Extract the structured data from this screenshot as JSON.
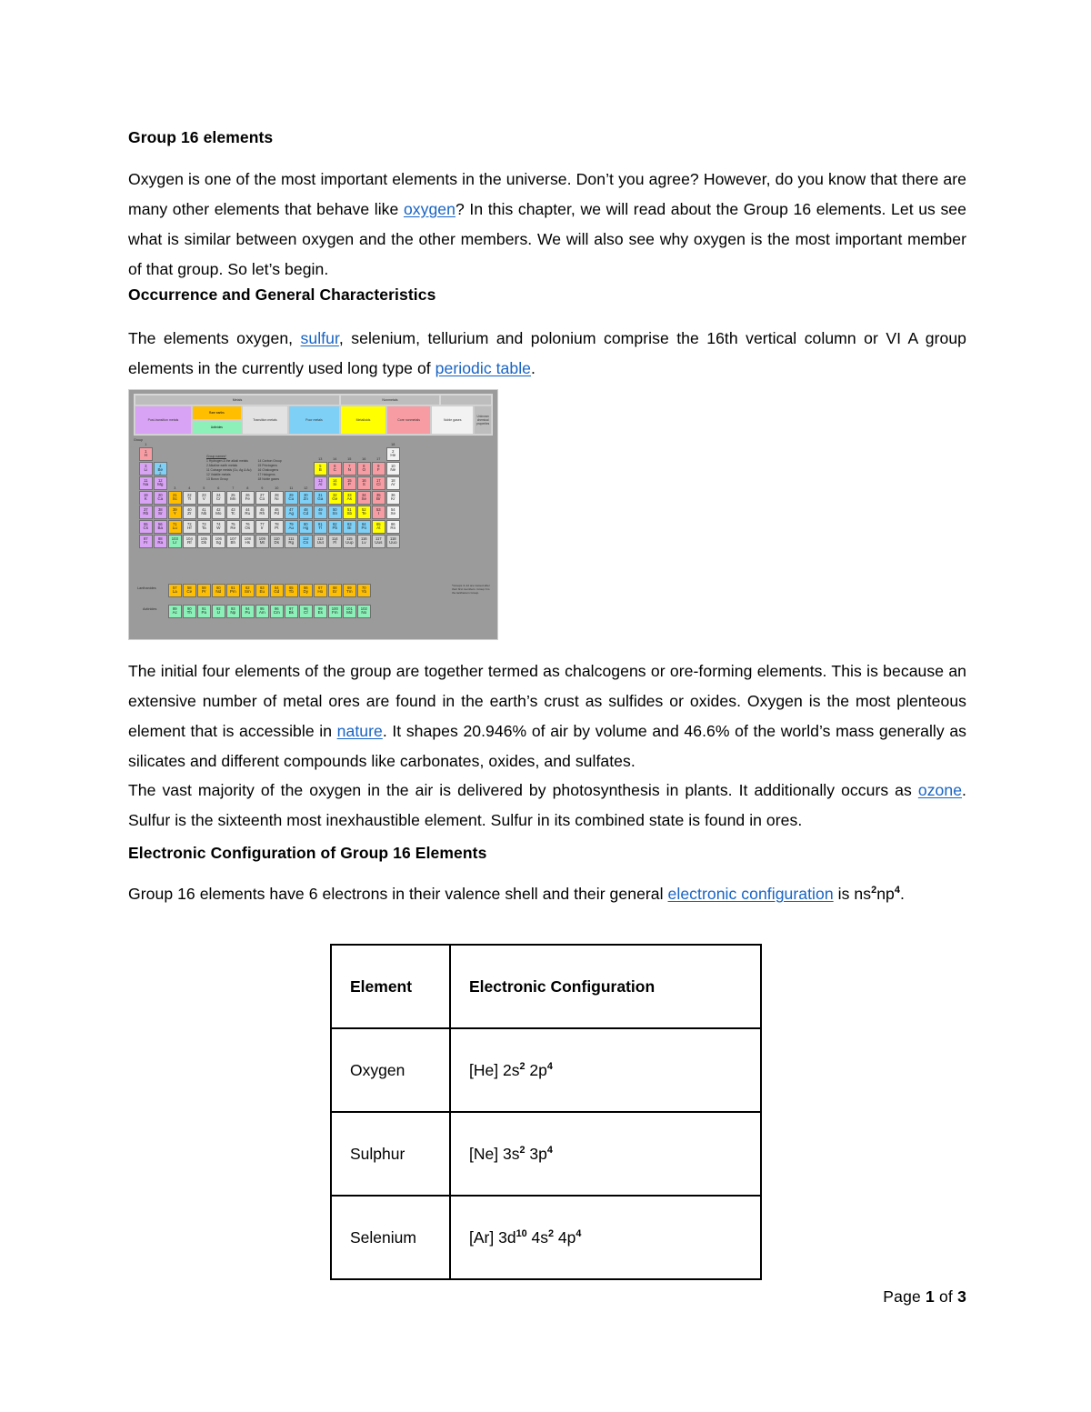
{
  "document": {
    "title": "Group 16 elements",
    "sections": [
      {
        "heading": "Group 16 elements",
        "paragraph_pre": "Oxygen is one of the most important elements in the universe. Don’t you agree? However, do you know that there are many other elements that behave like ",
        "link": "oxygen",
        "paragraph_post": "? In this chapter, we will read about the Group 16 elements. Let us see what is similar between oxygen and the other members. We will also see why oxygen is the most important member of that group. So let’s begin."
      },
      {
        "heading": "Occurrence and General Characteristics",
        "p2_a": "The elements oxygen, ",
        "p2_link1": "sulfur",
        "p2_b": ", selenium, tellurium and polonium comprise the 16th vertical column or VI A group elements in the currently used long type of ",
        "p2_link2": "periodic table",
        "p2_c": ".",
        "p3_a": "The initial four elements of the group are together termed as chalcogens or ore-forming elements. This is because an extensive number of metal ores are found in the earth’s crust as sulfides or oxides. Oxygen is the most plenteous element that is accessible in ",
        "p3_link": "nature",
        "p3_b": ". It shapes 20.946% of air by volume and 46.6% of the world’s mass generally as silicates and different compounds like carbonates, oxides, and sulfates.",
        "p4_a": "The vast majority of the oxygen in the air is delivered by photosynthesis in plants. It additionally occurs as ",
        "p4_link": "ozone",
        "p4_b": ". Sulfur is the sixteenth most inexhaustible element. Sulfur in its combined state is found in ores."
      },
      {
        "heading": "Electronic Configuration of Group 16 Elements",
        "p5_a": "Group 16 elements have 6 electrons in their valence shell and their general ",
        "p5_link": "electronic configuration",
        "p5_b": " is ns",
        "p5_sup1": "2",
        "p5_c": "np",
        "p5_sup2": "4",
        "p5_d": "."
      }
    ]
  },
  "config_table": {
    "headers": [
      "Element",
      "Electronic Configuration"
    ],
    "rows": [
      {
        "element": "Oxygen",
        "config_pre": "[He] 2s",
        "sup1": "2",
        "config_mid": " 2p",
        "sup2": "4",
        "config_post": ""
      },
      {
        "element": "Sulphur",
        "config_pre": "[Ne] 3s",
        "sup1": "2",
        "config_mid": " 3p",
        "sup2": "4",
        "config_post": ""
      },
      {
        "element": "Selenium",
        "config_pre": "[Ar] 3d",
        "sup1": "10",
        "config_mid": " 4s",
        "sup2": "2",
        "config_post": " 4p",
        "sup3": "4"
      }
    ]
  },
  "periodic_table_image": {
    "alt": "periodic-table-of-the-elements",
    "legend": {
      "metals_header": "Metals",
      "nonmetals_header": "Nonmetals",
      "unknown_header": "Unknown chemical properties",
      "categories": [
        "Post-transition metals",
        "Rare earths",
        "Actinides",
        "Transition metals",
        "Poor metals",
        "Metalloids",
        "Core nonmetals",
        "Noble gases",
        "Unknown chemical properties"
      ]
    },
    "group_label": "Group",
    "group_names_title": "Group names*",
    "group_names": [
      "1  Hydrogen & the alkali metals",
      "2  Alkaline earth metals",
      "11  Coinage metals (Cu, Ag & Au)",
      "12  Volatile metals",
      "13  Boron Group",
      "14  Carbon Group",
      "15  Pnictogens",
      "16  Chalcogens",
      "17  Halogens",
      "18  Noble gases"
    ],
    "series_labels": [
      "Lanthanides",
      "Actinides"
    ],
    "footnote": "*Groups 3–12 are named after their first members. Group 3 is the lanthanum Group.",
    "colors": {
      "background": "#9b9b9b",
      "alkali": "#f79ca3",
      "alkaline_earth": "#d9a3f5",
      "transition": "#e2e2e2",
      "poor_metals": "#7fd0f7",
      "metalloids": "#ffff00",
      "nonmetals": "#f79ca3",
      "noble_gases": "#f2f2f2",
      "lanthanides": "#ffbf00",
      "actinides": "#8cf0b8"
    },
    "elements": [
      {
        "z": "1",
        "sym": "H",
        "col": 1,
        "row": 1,
        "cat": "alkali"
      },
      {
        "z": "2",
        "sym": "He",
        "col": 18,
        "row": 1,
        "cat": "noble"
      },
      {
        "z": "3",
        "sym": "Li",
        "col": 1,
        "row": 2,
        "cat": "alkaline"
      },
      {
        "z": "4",
        "sym": "Be",
        "col": 2,
        "row": 2,
        "cat": "ptm"
      },
      {
        "z": "5",
        "sym": "B",
        "col": 13,
        "row": 2,
        "cat": "metalloid"
      },
      {
        "z": "6",
        "sym": "C",
        "col": 14,
        "row": 2,
        "cat": "nonmetal"
      },
      {
        "z": "7",
        "sym": "N",
        "col": 15,
        "row": 2,
        "cat": "nonmetal"
      },
      {
        "z": "8",
        "sym": "O",
        "col": 16,
        "row": 2,
        "cat": "nonmetal"
      },
      {
        "z": "9",
        "sym": "F",
        "col": 17,
        "row": 2,
        "cat": "nonmetal"
      },
      {
        "z": "10",
        "sym": "Ne",
        "col": 18,
        "row": 2,
        "cat": "noble"
      },
      {
        "z": "11",
        "sym": "Na",
        "col": 1,
        "row": 3,
        "cat": "alkaline"
      },
      {
        "z": "12",
        "sym": "Mg",
        "col": 2,
        "row": 3,
        "cat": "alkaline"
      },
      {
        "z": "13",
        "sym": "Al",
        "col": 13,
        "row": 3,
        "cat": "alkaline"
      },
      {
        "z": "14",
        "sym": "Si",
        "col": 14,
        "row": 3,
        "cat": "metalloid"
      },
      {
        "z": "15",
        "sym": "P",
        "col": 15,
        "row": 3,
        "cat": "nonmetal"
      },
      {
        "z": "16",
        "sym": "S",
        "col": 16,
        "row": 3,
        "cat": "nonmetal"
      },
      {
        "z": "17",
        "sym": "Cl",
        "col": 17,
        "row": 3,
        "cat": "nonmetal"
      },
      {
        "z": "18",
        "sym": "Ar",
        "col": 18,
        "row": 3,
        "cat": "noble"
      },
      {
        "z": "19",
        "sym": "K",
        "col": 1,
        "row": 4,
        "cat": "alkaline"
      },
      {
        "z": "20",
        "sym": "Ca",
        "col": 2,
        "row": 4,
        "cat": "alkaline"
      },
      {
        "z": "21",
        "sym": "Sc",
        "col": 3,
        "row": 4,
        "cat": "lanth"
      },
      {
        "z": "22",
        "sym": "Ti",
        "col": 4,
        "row": 4,
        "cat": "trans"
      },
      {
        "z": "23",
        "sym": "V",
        "col": 5,
        "row": 4,
        "cat": "trans"
      },
      {
        "z": "24",
        "sym": "Cr",
        "col": 6,
        "row": 4,
        "cat": "trans"
      },
      {
        "z": "25",
        "sym": "Mn",
        "col": 7,
        "row": 4,
        "cat": "trans"
      },
      {
        "z": "26",
        "sym": "Fe",
        "col": 8,
        "row": 4,
        "cat": "trans"
      },
      {
        "z": "27",
        "sym": "Co",
        "col": 9,
        "row": 4,
        "cat": "trans"
      },
      {
        "z": "28",
        "sym": "Ni",
        "col": 10,
        "row": 4,
        "cat": "trans"
      },
      {
        "z": "29",
        "sym": "Cu",
        "col": 11,
        "row": 4,
        "cat": "ptm"
      },
      {
        "z": "30",
        "sym": "Zn",
        "col": 12,
        "row": 4,
        "cat": "ptm"
      },
      {
        "z": "31",
        "sym": "Ga",
        "col": 13,
        "row": 4,
        "cat": "ptm"
      },
      {
        "z": "32",
        "sym": "Ge",
        "col": 14,
        "row": 4,
        "cat": "metalloid"
      },
      {
        "z": "33",
        "sym": "As",
        "col": 15,
        "row": 4,
        "cat": "metalloid"
      },
      {
        "z": "34",
        "sym": "Se",
        "col": 16,
        "row": 4,
        "cat": "nonmetal"
      },
      {
        "z": "35",
        "sym": "Br",
        "col": 17,
        "row": 4,
        "cat": "nonmetal"
      },
      {
        "z": "36",
        "sym": "Kr",
        "col": 18,
        "row": 4,
        "cat": "noble"
      },
      {
        "z": "37",
        "sym": "Rb",
        "col": 1,
        "row": 5,
        "cat": "alkaline"
      },
      {
        "z": "38",
        "sym": "Sr",
        "col": 2,
        "row": 5,
        "cat": "alkaline"
      },
      {
        "z": "39",
        "sym": "Y",
        "col": 3,
        "row": 5,
        "cat": "lanth"
      },
      {
        "z": "40",
        "sym": "Zr",
        "col": 4,
        "row": 5,
        "cat": "trans"
      },
      {
        "z": "41",
        "sym": "Nb",
        "col": 5,
        "row": 5,
        "cat": "trans"
      },
      {
        "z": "42",
        "sym": "Mo",
        "col": 6,
        "row": 5,
        "cat": "trans"
      },
      {
        "z": "43",
        "sym": "Tc",
        "col": 7,
        "row": 5,
        "cat": "trans"
      },
      {
        "z": "44",
        "sym": "Ru",
        "col": 8,
        "row": 5,
        "cat": "trans"
      },
      {
        "z": "45",
        "sym": "Rh",
        "col": 9,
        "row": 5,
        "cat": "trans"
      },
      {
        "z": "46",
        "sym": "Pd",
        "col": 10,
        "row": 5,
        "cat": "trans"
      },
      {
        "z": "47",
        "sym": "Ag",
        "col": 11,
        "row": 5,
        "cat": "ptm"
      },
      {
        "z": "48",
        "sym": "Cd",
        "col": 12,
        "row": 5,
        "cat": "ptm"
      },
      {
        "z": "49",
        "sym": "In",
        "col": 13,
        "row": 5,
        "cat": "ptm"
      },
      {
        "z": "50",
        "sym": "Sn",
        "col": 14,
        "row": 5,
        "cat": "ptm"
      },
      {
        "z": "51",
        "sym": "Sb",
        "col": 15,
        "row": 5,
        "cat": "metalloid"
      },
      {
        "z": "52",
        "sym": "Te",
        "col": 16,
        "row": 5,
        "cat": "metalloid"
      },
      {
        "z": "53",
        "sym": "I",
        "col": 17,
        "row": 5,
        "cat": "nonmetal"
      },
      {
        "z": "54",
        "sym": "Xe",
        "col": 18,
        "row": 5,
        "cat": "noble"
      },
      {
        "z": "55",
        "sym": "Cs",
        "col": 1,
        "row": 6,
        "cat": "alkaline"
      },
      {
        "z": "56",
        "sym": "Ba",
        "col": 2,
        "row": 6,
        "cat": "alkaline"
      },
      {
        "z": "71",
        "sym": "Lu",
        "col": 3,
        "row": 6,
        "cat": "lanth"
      },
      {
        "z": "72",
        "sym": "Hf",
        "col": 4,
        "row": 6,
        "cat": "trans"
      },
      {
        "z": "73",
        "sym": "Ta",
        "col": 5,
        "row": 6,
        "cat": "trans"
      },
      {
        "z": "74",
        "sym": "W",
        "col": 6,
        "row": 6,
        "cat": "trans"
      },
      {
        "z": "75",
        "sym": "Re",
        "col": 7,
        "row": 6,
        "cat": "trans"
      },
      {
        "z": "76",
        "sym": "Os",
        "col": 8,
        "row": 6,
        "cat": "trans"
      },
      {
        "z": "77",
        "sym": "Ir",
        "col": 9,
        "row": 6,
        "cat": "trans"
      },
      {
        "z": "78",
        "sym": "Pt",
        "col": 10,
        "row": 6,
        "cat": "trans"
      },
      {
        "z": "79",
        "sym": "Au",
        "col": 11,
        "row": 6,
        "cat": "ptm"
      },
      {
        "z": "80",
        "sym": "Hg",
        "col": 12,
        "row": 6,
        "cat": "ptm"
      },
      {
        "z": "81",
        "sym": "Tl",
        "col": 13,
        "row": 6,
        "cat": "ptm"
      },
      {
        "z": "82",
        "sym": "Pb",
        "col": 14,
        "row": 6,
        "cat": "ptm"
      },
      {
        "z": "83",
        "sym": "Bi",
        "col": 15,
        "row": 6,
        "cat": "ptm"
      },
      {
        "z": "84",
        "sym": "Po",
        "col": 16,
        "row": 6,
        "cat": "ptm"
      },
      {
        "z": "85",
        "sym": "At",
        "col": 17,
        "row": 6,
        "cat": "metalloid"
      },
      {
        "z": "86",
        "sym": "Rn",
        "col": 18,
        "row": 6,
        "cat": "noble"
      },
      {
        "z": "87",
        "sym": "Fr",
        "col": 1,
        "row": 7,
        "cat": "alkaline"
      },
      {
        "z": "88",
        "sym": "Ra",
        "col": 2,
        "row": 7,
        "cat": "alkaline"
      },
      {
        "z": "103",
        "sym": "Lr",
        "col": 3,
        "row": 7,
        "cat": "actin"
      },
      {
        "z": "104",
        "sym": "Rf",
        "col": 4,
        "row": 7,
        "cat": "trans"
      },
      {
        "z": "105",
        "sym": "Db",
        "col": 5,
        "row": 7,
        "cat": "trans"
      },
      {
        "z": "106",
        "sym": "Sg",
        "col": 6,
        "row": 7,
        "cat": "trans"
      },
      {
        "z": "107",
        "sym": "Bh",
        "col": 7,
        "row": 7,
        "cat": "trans"
      },
      {
        "z": "108",
        "sym": "Hs",
        "col": 8,
        "row": 7,
        "cat": "trans"
      },
      {
        "z": "109",
        "sym": "Mt",
        "col": 9,
        "row": 7,
        "cat": "unknown"
      },
      {
        "z": "110",
        "sym": "Ds",
        "col": 10,
        "row": 7,
        "cat": "unknown"
      },
      {
        "z": "111",
        "sym": "Rg",
        "col": 11,
        "row": 7,
        "cat": "unknown"
      },
      {
        "z": "112",
        "sym": "Cn",
        "col": 12,
        "row": 7,
        "cat": "ptm"
      },
      {
        "z": "113",
        "sym": "Uut",
        "col": 13,
        "row": 7,
        "cat": "unknown"
      },
      {
        "z": "114",
        "sym": "Fl",
        "col": 14,
        "row": 7,
        "cat": "unknown"
      },
      {
        "z": "115",
        "sym": "Uup",
        "col": 15,
        "row": 7,
        "cat": "unknown"
      },
      {
        "z": "116",
        "sym": "Lv",
        "col": 16,
        "row": 7,
        "cat": "unknown"
      },
      {
        "z": "117",
        "sym": "Uus",
        "col": 17,
        "row": 7,
        "cat": "unknown"
      },
      {
        "z": "118",
        "sym": "Uuo",
        "col": 18,
        "row": 7,
        "cat": "unknown"
      }
    ],
    "lanthanides": [
      {
        "z": "57",
        "sym": "La"
      },
      {
        "z": "58",
        "sym": "Ce"
      },
      {
        "z": "59",
        "sym": "Pr"
      },
      {
        "z": "60",
        "sym": "Nd"
      },
      {
        "z": "61",
        "sym": "Pm"
      },
      {
        "z": "62",
        "sym": "Sm"
      },
      {
        "z": "63",
        "sym": "Eu"
      },
      {
        "z": "64",
        "sym": "Gd"
      },
      {
        "z": "65",
        "sym": "Tb"
      },
      {
        "z": "66",
        "sym": "Dy"
      },
      {
        "z": "67",
        "sym": "Ho"
      },
      {
        "z": "68",
        "sym": "Er"
      },
      {
        "z": "69",
        "sym": "Tm"
      },
      {
        "z": "70",
        "sym": "Yb"
      }
    ],
    "actinides": [
      {
        "z": "89",
        "sym": "Ac"
      },
      {
        "z": "90",
        "sym": "Th"
      },
      {
        "z": "91",
        "sym": "Pa"
      },
      {
        "z": "92",
        "sym": "U"
      },
      {
        "z": "93",
        "sym": "Np"
      },
      {
        "z": "94",
        "sym": "Pu"
      },
      {
        "z": "95",
        "sym": "Am"
      },
      {
        "z": "96",
        "sym": "Cm"
      },
      {
        "z": "97",
        "sym": "Bk"
      },
      {
        "z": "98",
        "sym": "Cf"
      },
      {
        "z": "99",
        "sym": "Es"
      },
      {
        "z": "100",
        "sym": "Fm"
      },
      {
        "z": "101",
        "sym": "Md"
      },
      {
        "z": "102",
        "sym": "No"
      }
    ]
  },
  "footer": {
    "prefix": "Page ",
    "current": "1",
    "middle": " of ",
    "total": "3"
  }
}
